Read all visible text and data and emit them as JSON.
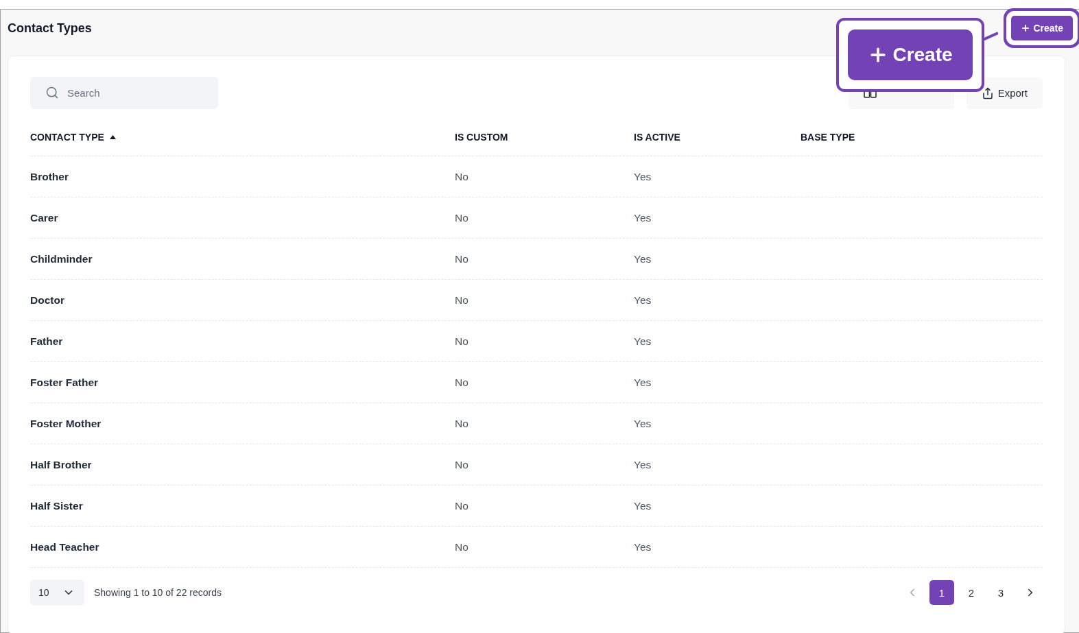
{
  "page": {
    "title": "Contact Types",
    "create_button": "Create"
  },
  "callout": {
    "label": "Create"
  },
  "toolbar": {
    "search": {
      "placeholder": "Search"
    },
    "export_button": "Export"
  },
  "table": {
    "columns": [
      {
        "label": "CONTACT TYPE",
        "sorted": true
      },
      {
        "label": "IS CUSTOM",
        "sorted": false
      },
      {
        "label": "IS ACTIVE",
        "sorted": false
      },
      {
        "label": "BASE TYPE",
        "sorted": false
      }
    ],
    "rows": [
      {
        "name": "Brother",
        "is_custom": "No",
        "is_active": "Yes"
      },
      {
        "name": "Carer",
        "is_custom": "No",
        "is_active": "Yes"
      },
      {
        "name": "Childminder",
        "is_custom": "No",
        "is_active": "Yes"
      },
      {
        "name": "Doctor",
        "is_custom": "No",
        "is_active": "Yes"
      },
      {
        "name": "Father",
        "is_custom": "No",
        "is_active": "Yes"
      },
      {
        "name": "Foster Father",
        "is_custom": "No",
        "is_active": "Yes"
      },
      {
        "name": "Foster Mother",
        "is_custom": "No",
        "is_active": "Yes"
      },
      {
        "name": "Half Brother",
        "is_custom": "No",
        "is_active": "Yes"
      },
      {
        "name": "Half Sister",
        "is_custom": "No",
        "is_active": "Yes"
      },
      {
        "name": "Head Teacher",
        "is_custom": "No",
        "is_active": "Yes"
      }
    ]
  },
  "footer": {
    "page_size": "10",
    "summary": "Showing 1 to 10 of 22 records",
    "pages": [
      {
        "label": "1",
        "selected": true
      },
      {
        "label": "2",
        "selected": false
      },
      {
        "label": "3",
        "selected": false
      }
    ]
  }
}
